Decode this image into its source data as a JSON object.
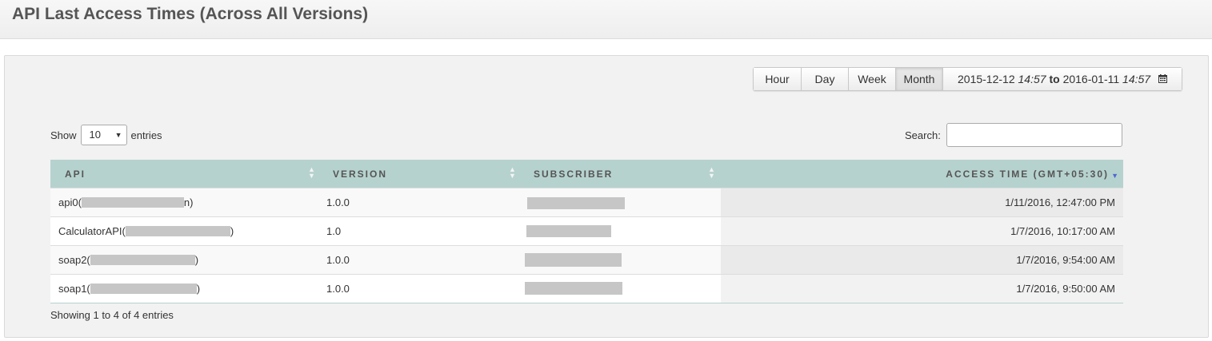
{
  "page": {
    "title": "API Last Access Times (Across All Versions)"
  },
  "range": {
    "buttons": [
      "Hour",
      "Day",
      "Week",
      "Month"
    ],
    "active": "Month",
    "from_date": "2015-12-12",
    "from_time": "14:57",
    "to_word": "to",
    "to_date": "2016-01-11",
    "to_time": "14:57",
    "calendar_icon": "calendar-icon"
  },
  "length": {
    "show_label": "Show",
    "value": "10",
    "entries_label": "entries"
  },
  "search": {
    "label": "Search:",
    "value": "",
    "placeholder": ""
  },
  "table": {
    "columns": [
      "API",
      "VERSION",
      "SUBSCRIBER",
      "ACCESS TIME (GMT+05:30)"
    ],
    "sorted_column": "ACCESS TIME (GMT+05:30)",
    "sort_direction": "desc",
    "rows": [
      {
        "api_name": "api0(",
        "api_suffix": "n)",
        "version": "1.0.0",
        "access_time": "1/11/2016, 12:47:00 PM"
      },
      {
        "api_name": "CalculatorAPI(",
        "api_suffix": ")",
        "version": "1.0",
        "access_time": "1/7/2016, 10:17:00 AM"
      },
      {
        "api_name": "soap2(",
        "api_suffix": ")",
        "version": "1.0.0",
        "access_time": "1/7/2016, 9:54:00 AM"
      },
      {
        "api_name": "soap1(",
        "api_suffix": ")",
        "version": "1.0.0",
        "access_time": "1/7/2016, 9:50:00 AM"
      }
    ]
  },
  "info": "Showing 1 to 4 of 4 entries",
  "colors": {
    "header_bg": "#b6d2ce",
    "panel_bg": "#f2f2f2",
    "sort_active": "#5068d0",
    "redaction": "#c6c6c6"
  }
}
